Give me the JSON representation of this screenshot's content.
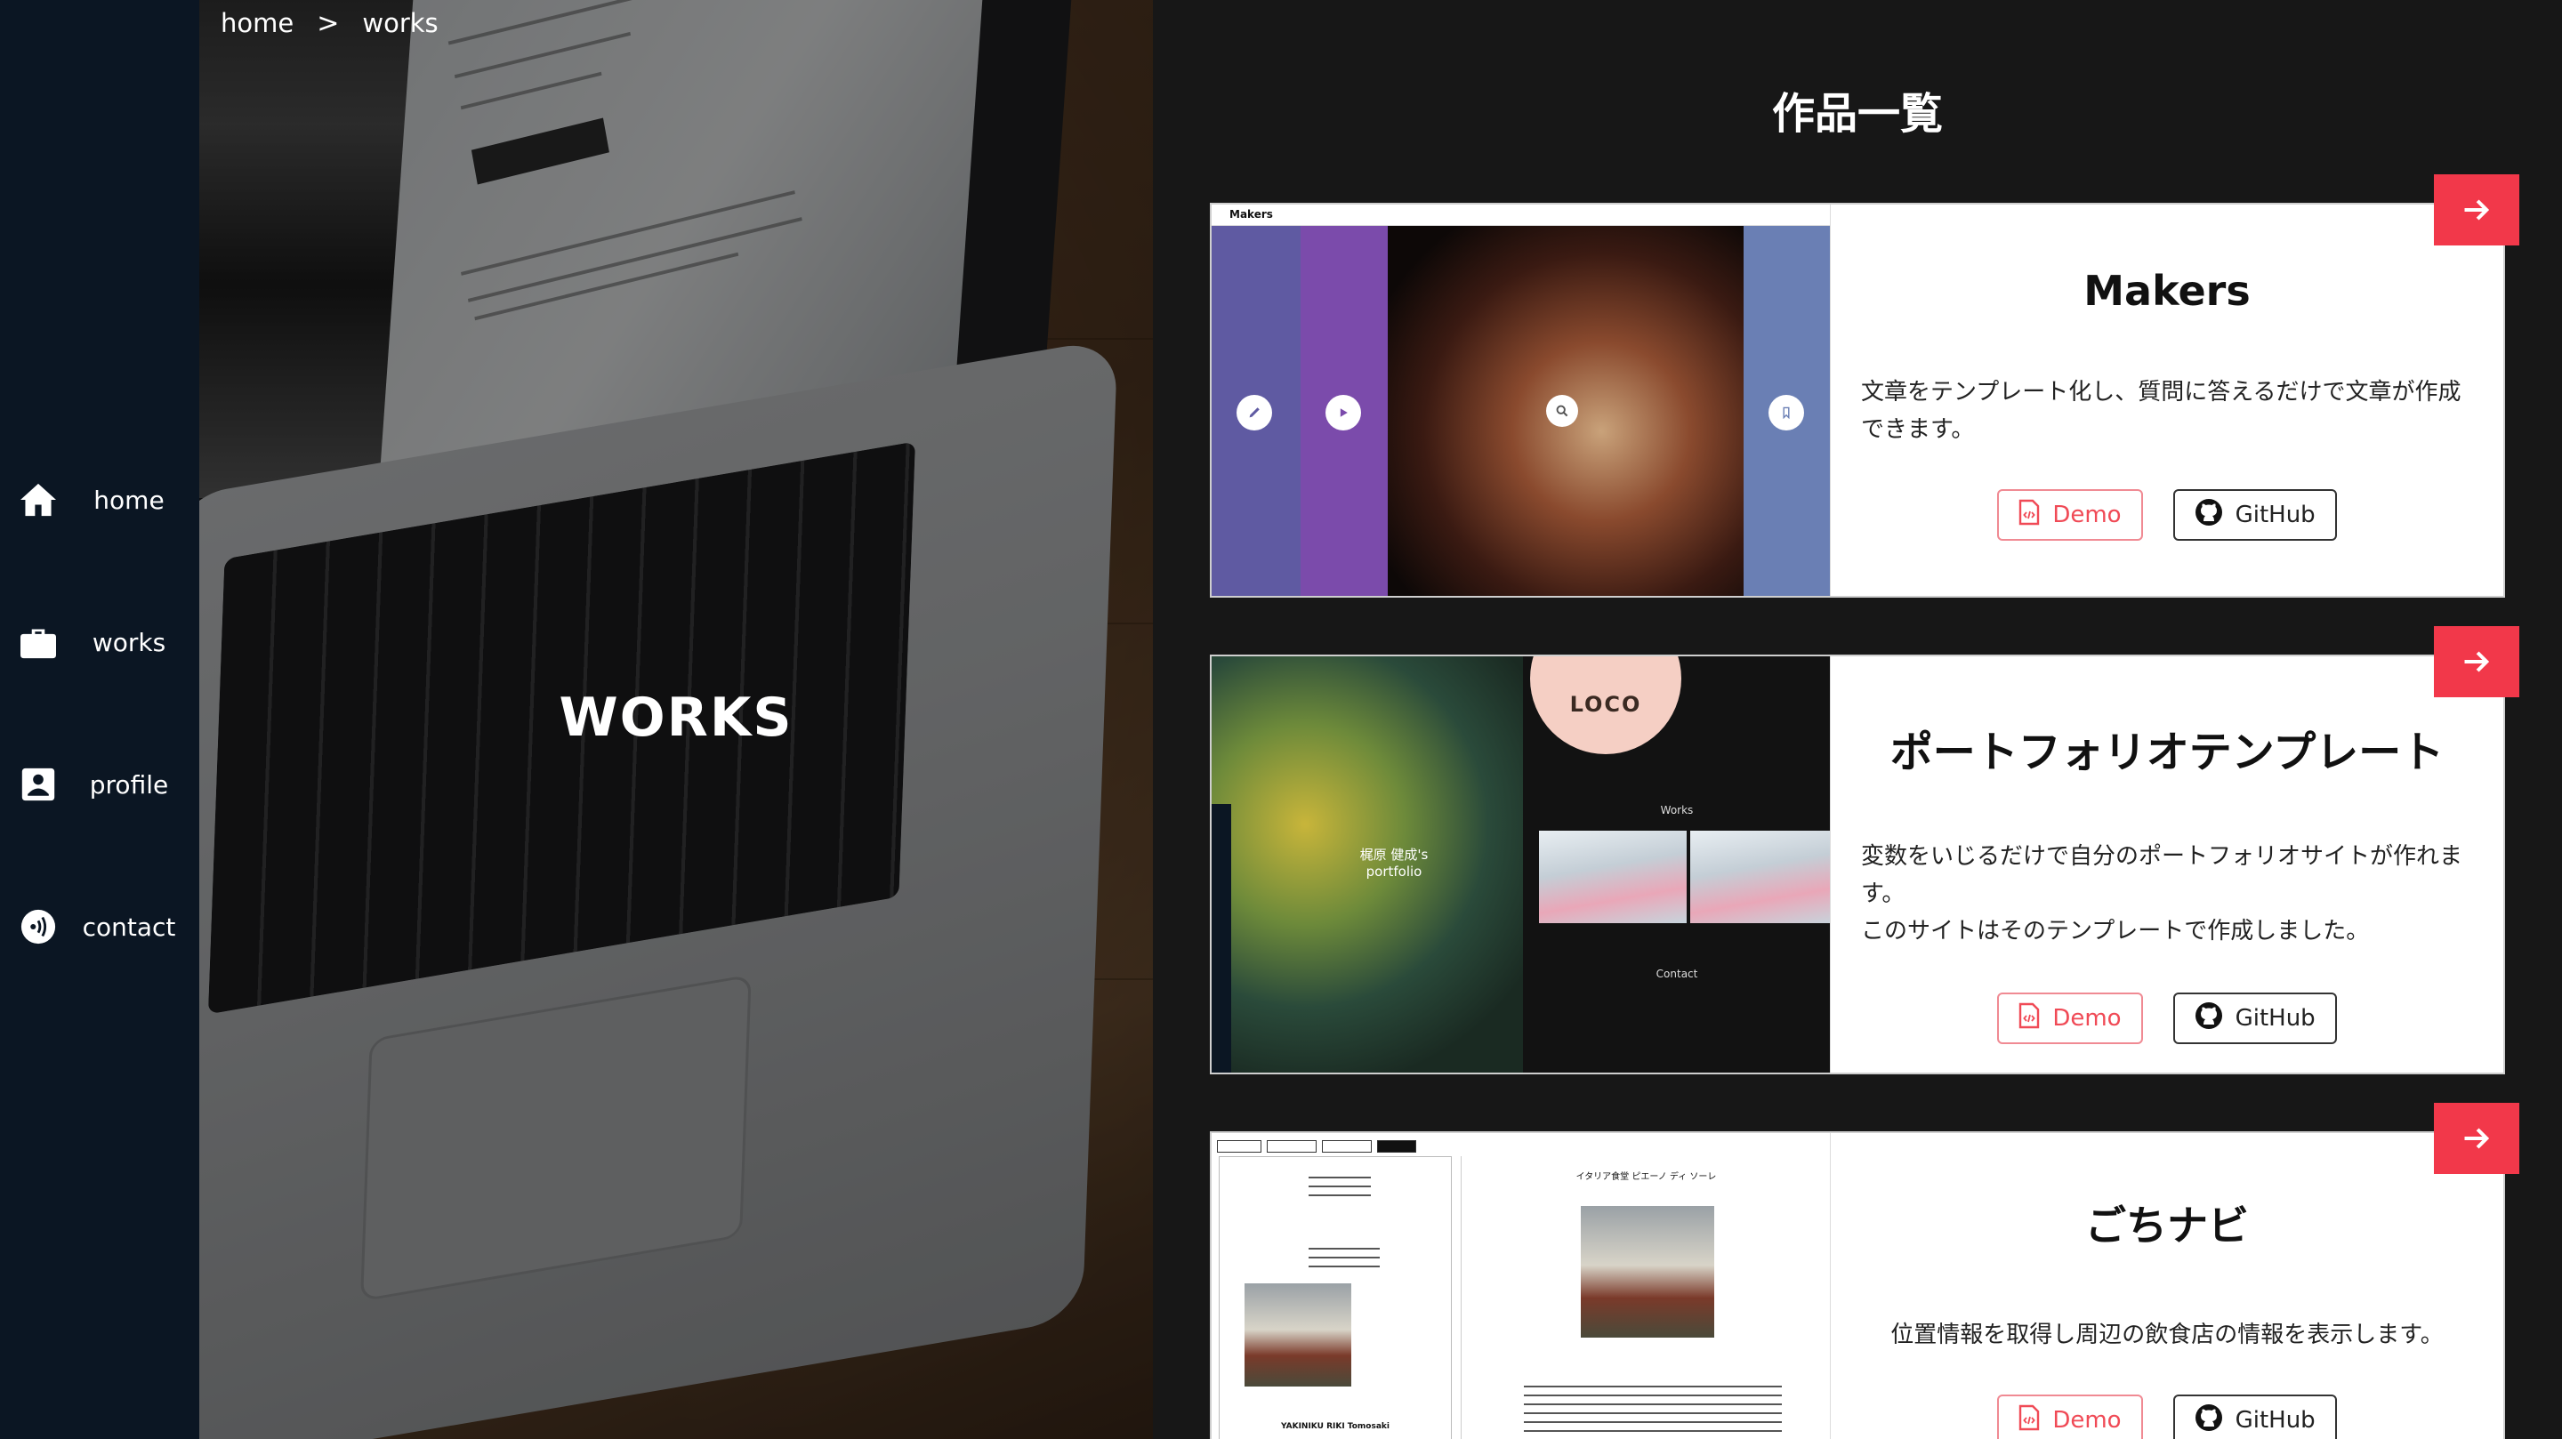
{
  "sidebar": {
    "items": [
      {
        "label": "home",
        "icon": "home-icon"
      },
      {
        "label": "works",
        "icon": "briefcase-icon"
      },
      {
        "label": "profile",
        "icon": "profile-card-icon"
      },
      {
        "label": "contact",
        "icon": "contact-wave-icon"
      }
    ]
  },
  "breadcrumb": {
    "home": "home",
    "separator": ">",
    "current": "works"
  },
  "hero": {
    "title": "WORKS"
  },
  "main": {
    "title": "作品一覧",
    "works": [
      {
        "title": "Makers",
        "description": "文章をテンプレート化し、質問に答えるだけで文章が作成できます。",
        "demo_label": "Demo",
        "github_label": "GitHub",
        "screenshot": {
          "brand": "Makers"
        }
      },
      {
        "title": "ポートフォリオテンプレート",
        "description": "変数をいじるだけで自分のポートフォリオサイトが作れます。\nこのサイトはそのテンプレートで作成しました。",
        "demo_label": "Demo",
        "github_label": "GitHub",
        "screenshot": {
          "logo": "LOCO",
          "works_heading": "Works",
          "contact_heading": "Contact",
          "name": "梶原 健成's portfolio"
        }
      },
      {
        "title": "ごちナビ",
        "description": "位置情報を取得し周辺の飲食店の情報を表示します。",
        "demo_label": "Demo",
        "github_label": "GitHub",
        "screenshot": {
          "shop_name": "イタリア食堂 ピエーノ ディ ソーレ",
          "list_item": "YAKINIKU RIKI Tomosaki"
        }
      }
    ]
  },
  "colors": {
    "sidebar": "#0b1623",
    "background": "#171717",
    "accent": "#f2384a",
    "demo": "#f04a56"
  }
}
